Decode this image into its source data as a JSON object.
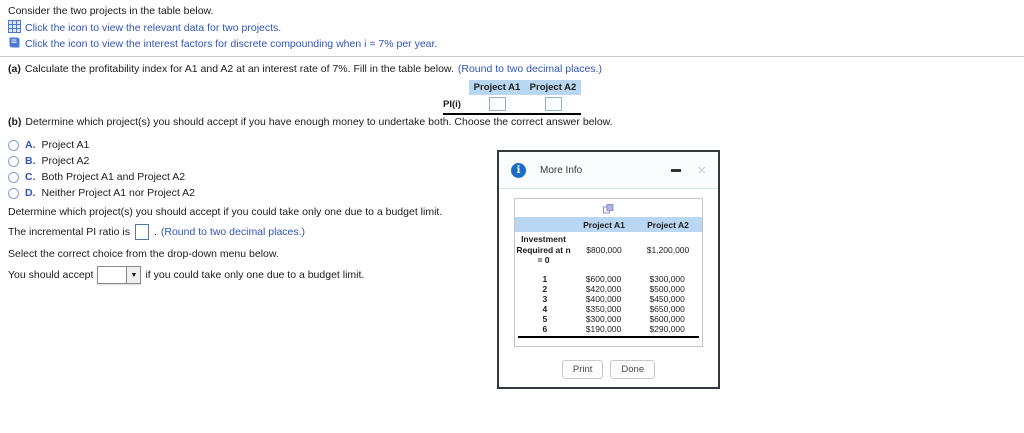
{
  "icons": {
    "close": "×",
    "dropdown_arrow": "▼"
  },
  "colors": {
    "accent_blue": "#2f55b8",
    "table_header_blue": "#b9d7f2",
    "info_icon_blue": "#1b6ec8"
  },
  "intro": "Consider the two projects in the table below.",
  "data_link": {
    "label": "Click the icon to view the relevant data for two projects."
  },
  "factors_link": {
    "label": "Click the icon to view the interest factors for discrete compounding when i = 7% per year."
  },
  "part_a": {
    "label": "(a)",
    "prompt": "Calculate the profitability index for A1 and A2 at an interest rate of 7%. Fill in the table below.",
    "note": "(Round to two decimal places.)",
    "table": {
      "col_a1": "Project A1",
      "col_a2": "Project A2",
      "row_label": "PI(i)"
    }
  },
  "part_b": {
    "label": "(b)",
    "prompt": "Determine which project(s) you should accept if you have enough money to undertake both. Choose the correct answer below.",
    "options": [
      {
        "letter": "A.",
        "label": "Project A1"
      },
      {
        "letter": "B.",
        "label": "Project A2"
      },
      {
        "letter": "C.",
        "label": "Both Project A1 and Project A2"
      },
      {
        "letter": "D.",
        "label": "Neither Project A1 nor Project A2"
      }
    ]
  },
  "part_c": {
    "prompt": "Determine which project(s) you should accept if you could take only one due to a budget limit.",
    "ratio_text": "The incremental PI ratio is",
    "ratio_period": ".",
    "note": "(Round to two decimal places.)",
    "select_prompt": "Select the correct choice from the drop-down menu below.",
    "accept_text": "You should accept",
    "accept_suffix": "if you could take only one due to a budget limit."
  },
  "dialog": {
    "title": "More Info",
    "table": {
      "col_a1": "Project A1",
      "col_a2": "Project A2",
      "investment_label": "Investment Required at n = 0",
      "investment_a1": "$800,000",
      "investment_a2": "$1,200,000",
      "rows": [
        [
          "1",
          "$600,000",
          "$300,000"
        ],
        [
          "2",
          "$420,000",
          "$500,000"
        ],
        [
          "3",
          "$400,000",
          "$450,000"
        ],
        [
          "4",
          "$350,000",
          "$650,000"
        ],
        [
          "5",
          "$300,000",
          "$600,000"
        ],
        [
          "6",
          "$190,000",
          "$290,000"
        ]
      ]
    },
    "print_label": "Print",
    "done_label": "Done"
  }
}
